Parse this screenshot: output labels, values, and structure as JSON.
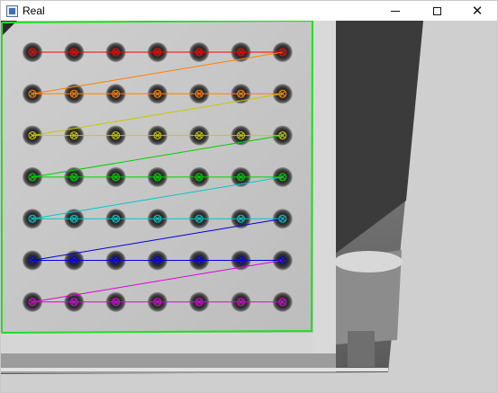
{
  "window": {
    "title": "Real",
    "app_icon": "opencv-window-icon",
    "controls": {
      "minimize": "minimize-icon",
      "maximize": "maximize-icon",
      "close": "close-icon"
    }
  },
  "calibration": {
    "board_rows": 7,
    "board_cols": 7,
    "row_colors": [
      "#ff0000",
      "#ff8000",
      "#c8c800",
      "#00d000",
      "#00c8c8",
      "#0000e0",
      "#e000e0"
    ],
    "border_color": "#22dd22"
  }
}
